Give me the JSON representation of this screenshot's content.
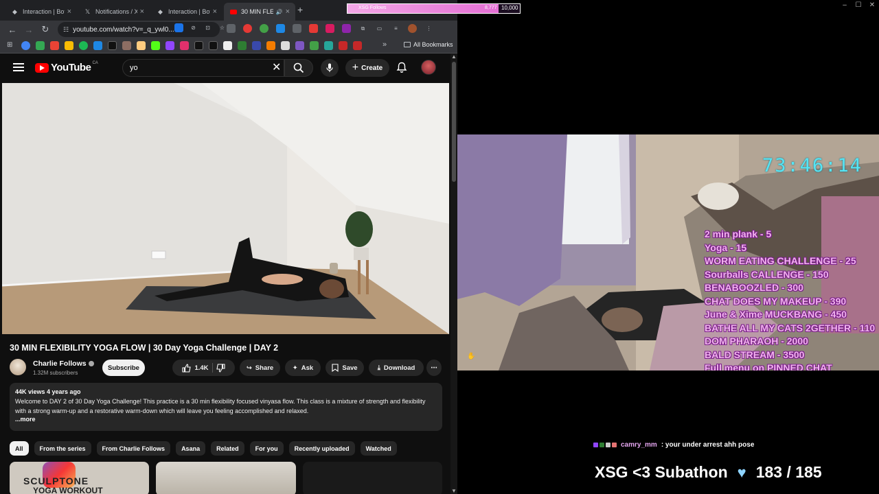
{
  "browser": {
    "tabs": [
      {
        "title": "Interaction | Bot",
        "icon": "bot-icon"
      },
      {
        "title": "Notifications / X",
        "icon": "x-icon"
      },
      {
        "title": "Interaction | Bot",
        "icon": "bot-icon"
      },
      {
        "title": "30 MIN FLE",
        "icon": "youtube-icon",
        "active": true
      }
    ],
    "url": "youtube.com/watch?v=_q_ywl0...",
    "bookmarks_label": "All Bookmarks"
  },
  "youtube": {
    "logo": "YouTube",
    "region": "CA",
    "search_value": "yo",
    "create_label": "Create",
    "video_title": "30 MIN FLEXIBILITY YOGA FLOW | 30 Day Yoga Challenge | DAY 2",
    "channel_name": "Charlie Follows",
    "subscribers": "1.32M subscribers",
    "subscribe_label": "Subscribe",
    "likes": "1.4K",
    "share_label": "Share",
    "ask_label": "Ask",
    "save_label": "Save",
    "download_label": "Download",
    "views_age": "44K views  4 years ago",
    "description": "Welcome to DAY 2 of 30 Day Yoga Challenge! This practice is a 30 min flexibility focused vinyasa flow. This class is a mixture of strength and flexibility with a strong warm-up and a restorative warm-down which will leave you feeling accomplished and relaxed.",
    "more_label": "...more",
    "chips": [
      "All",
      "From the series",
      "From Charlie Follows",
      "Asana",
      "Related",
      "For you",
      "Recently uploaded",
      "Watched"
    ],
    "thumb1_line1": "SCULPTONE",
    "thumb1_line2": "YOGA WORKOUT"
  },
  "stream": {
    "follow_label": "XSG Follows",
    "follow_count": "8,777",
    "follow_goal": "10,000",
    "follow_progress": 0.8777,
    "timer": "73:46:14",
    "menu": [
      "2 min plank - 5",
      "Yoga - 15",
      "WORM EATING CHALLENGE - 25",
      "Sourballs CALLENGE - 150",
      "BENABOOZLED - 300",
      "CHAT DOES MY MAKEUP - 390",
      "June & Xime MUCKBANG - 450",
      "BATHE ALL MY CATS 2GETHER - 110",
      "DOM PHARAOH - 2000",
      "BALD STREAM - 3500",
      "Full menu on PINNED CHAT"
    ],
    "chat_user": "camry_mm",
    "chat_message": ": your under arrest ahh pose",
    "subathon_label": "XSG <3 Subathon",
    "subathon_count": "183 / 185"
  },
  "colors": {
    "timer": "#56e4f4",
    "menu_text": "#f2b3ee",
    "yt_red": "#ff0000"
  }
}
